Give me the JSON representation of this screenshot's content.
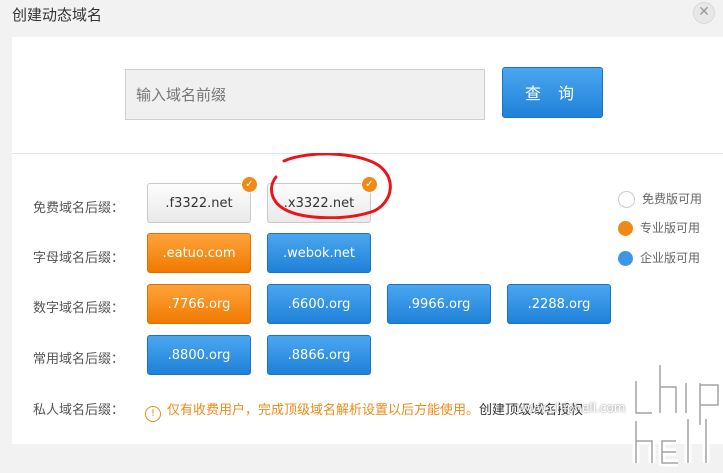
{
  "dialog": {
    "title": "创建动态域名",
    "close_icon": "close-icon"
  },
  "search": {
    "placeholder": "输入域名前缀",
    "button_label": "查 询"
  },
  "rows": [
    {
      "label": "免费域名后缀：",
      "buttons": [
        {
          "text": ".f3322.net",
          "style": "gray",
          "checked": true
        },
        {
          "text": ".x3322.net",
          "style": "gray",
          "checked": true
        }
      ]
    },
    {
      "label": "字母域名后缀：",
      "buttons": [
        {
          "text": ".eatuo.com",
          "style": "orange"
        },
        {
          "text": ".webok.net",
          "style": "blue"
        }
      ]
    },
    {
      "label": "数字域名后缀：",
      "buttons": [
        {
          "text": ".7766.org",
          "style": "orange"
        },
        {
          "text": ".6600.org",
          "style": "blue"
        },
        {
          "text": ".9966.org",
          "style": "blue"
        },
        {
          "text": ".2288.org",
          "style": "blue"
        }
      ]
    },
    {
      "label": "常用域名后缀：",
      "buttons": [
        {
          "text": ".8800.org",
          "style": "blue"
        },
        {
          "text": ".8866.org",
          "style": "blue"
        }
      ]
    },
    {
      "label": "私人域名后缀："
    }
  ],
  "legend": [
    {
      "label": "免费版可用",
      "color": "#ffffff"
    },
    {
      "label": "专业版可用",
      "color": "#f08a17"
    },
    {
      "label": "企业版可用",
      "color": "#3d97e6"
    }
  ],
  "private_note": {
    "text": "仅有收费用户，完成顶级域名解析设置以后方能使用。",
    "link": "创建顶级域名授权"
  },
  "watermark": {
    "text": "www.chiphell.com"
  },
  "colors": {
    "orange": "#f08a17",
    "blue": "#2a8be0",
    "annotation_red": "#e8151b"
  }
}
